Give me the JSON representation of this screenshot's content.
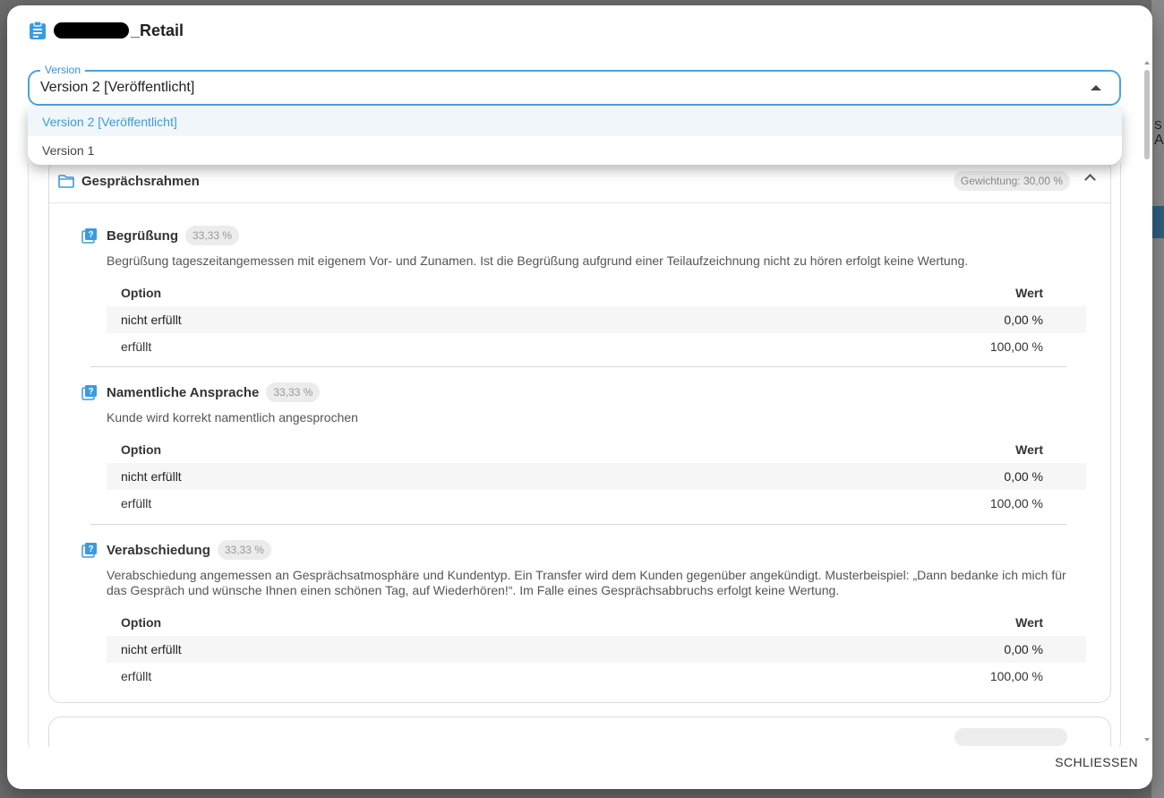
{
  "dialog": {
    "title_suffix": "_Retail",
    "header_icon": "clipboard-icon",
    "close_label": "SCHLIESSEN"
  },
  "version_select": {
    "label": "Version",
    "value": "Version 2 [Veröffentlicht]",
    "options": [
      {
        "label": "Version 2 [Veröffentlicht]",
        "selected": true
      },
      {
        "label": "Version 1",
        "selected": false
      }
    ]
  },
  "background": {
    "right_text_1": "S",
    "right_text_2": "A"
  },
  "section": {
    "title": "Gesprächsrahmen",
    "weight": "Gewichtung: 30,00 %",
    "icon": "folder-icon",
    "questions": [
      {
        "title": "Begrüßung",
        "weight": "33,33 %",
        "description": "Begrüßung tageszeitangemessen mit eigenem Vor- und Zunamen. Ist die Begrüßung aufgrund einer Teilaufzeichnung nicht zu hören erfolgt keine Wertung.",
        "header_option": "Option",
        "header_value": "Wert",
        "rows": [
          {
            "option": "nicht erfüllt",
            "value": "0,00 %"
          },
          {
            "option": "erfüllt",
            "value": "100,00 %"
          }
        ]
      },
      {
        "title": "Namentliche Ansprache",
        "weight": "33,33 %",
        "description": "Kunde wird korrekt namentlich angesprochen",
        "header_option": "Option",
        "header_value": "Wert",
        "rows": [
          {
            "option": "nicht erfüllt",
            "value": "0,00 %"
          },
          {
            "option": "erfüllt",
            "value": "100,00 %"
          }
        ]
      },
      {
        "title": "Verabschiedung",
        "weight": "33,33 %",
        "description": "Verabschiedung angemessen an Gesprächsatmosphäre und Kundentyp. Ein Transfer wird dem Kunden gegenüber angekündigt. Musterbeispiel: „Dann bedanke ich mich für das Gespräch und wünsche Ihnen einen schönen Tag, auf Wiederhören!“. Im Falle eines Gesprächsabbruchs erfolgt keine Wertung.",
        "header_option": "Option",
        "header_value": "Wert",
        "rows": [
          {
            "option": "nicht erfüllt",
            "value": "0,00 %"
          },
          {
            "option": "erfüllt",
            "value": "100,00 %"
          }
        ]
      }
    ]
  },
  "colors": {
    "accent": "#3a9be0",
    "chip_bg": "#ececec"
  }
}
